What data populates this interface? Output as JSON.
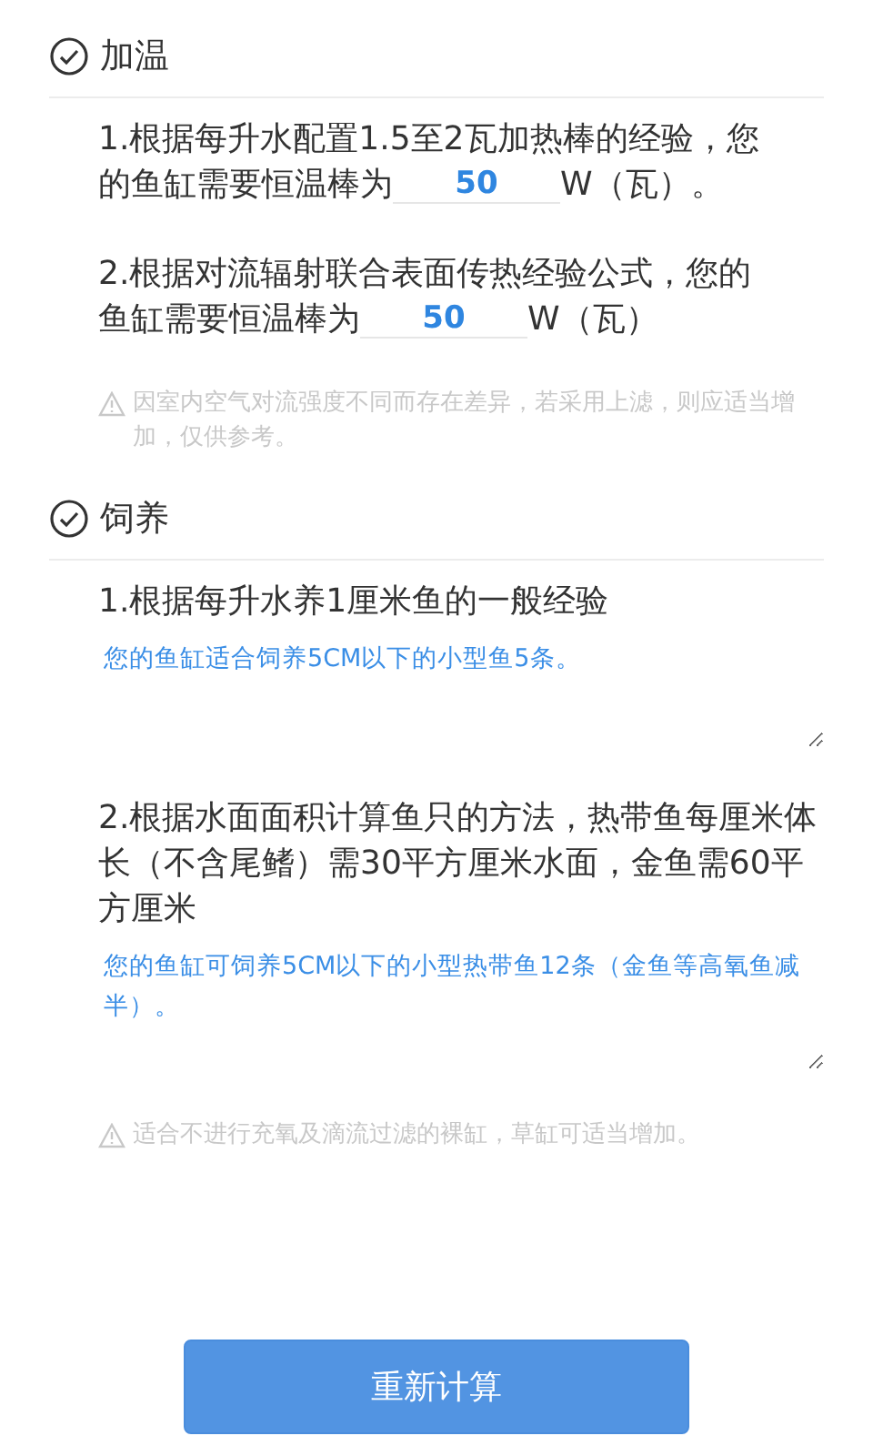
{
  "sections": [
    {
      "title": "加温",
      "checked": true,
      "kind": "heating",
      "items": [
        {
          "line_1": "1.根据每升水配置1.5至2瓦加热棒的经验，您",
          "text_before": "的鱼缸需要恒温棒为",
          "value": "50",
          "text_after": "W（瓦）。"
        },
        {
          "line_1": "2.根据对流辐射联合表面传热经验公式，您的",
          "text_before": "鱼缸需要恒温棒为",
          "value": "50",
          "text_after": "W（瓦）"
        }
      ],
      "note": "因室内空气对流强度不同而存在差异，若采用上滤，则应适当增加，仅供参考。"
    },
    {
      "title": "饲养",
      "checked": true,
      "kind": "feeding",
      "items": [
        {
          "question": "1.根据每升水养1厘米鱼的一般经验",
          "answer": "您的鱼缸适合饲养5CM以下的小型鱼5条。"
        },
        {
          "question": "2.根据水面面积计算鱼只的方法，热带鱼每厘米体长（不含尾鳍）需30平方厘米水面，金鱼需60平方厘米",
          "answer": "您的鱼缸可饲养5CM以下的小型热带鱼12条（金鱼等高氧鱼减半）。"
        }
      ],
      "note": "适合不进行充氧及滴流过滤的裸缸，草缸可适当增加。"
    }
  ],
  "button": "重新计算"
}
